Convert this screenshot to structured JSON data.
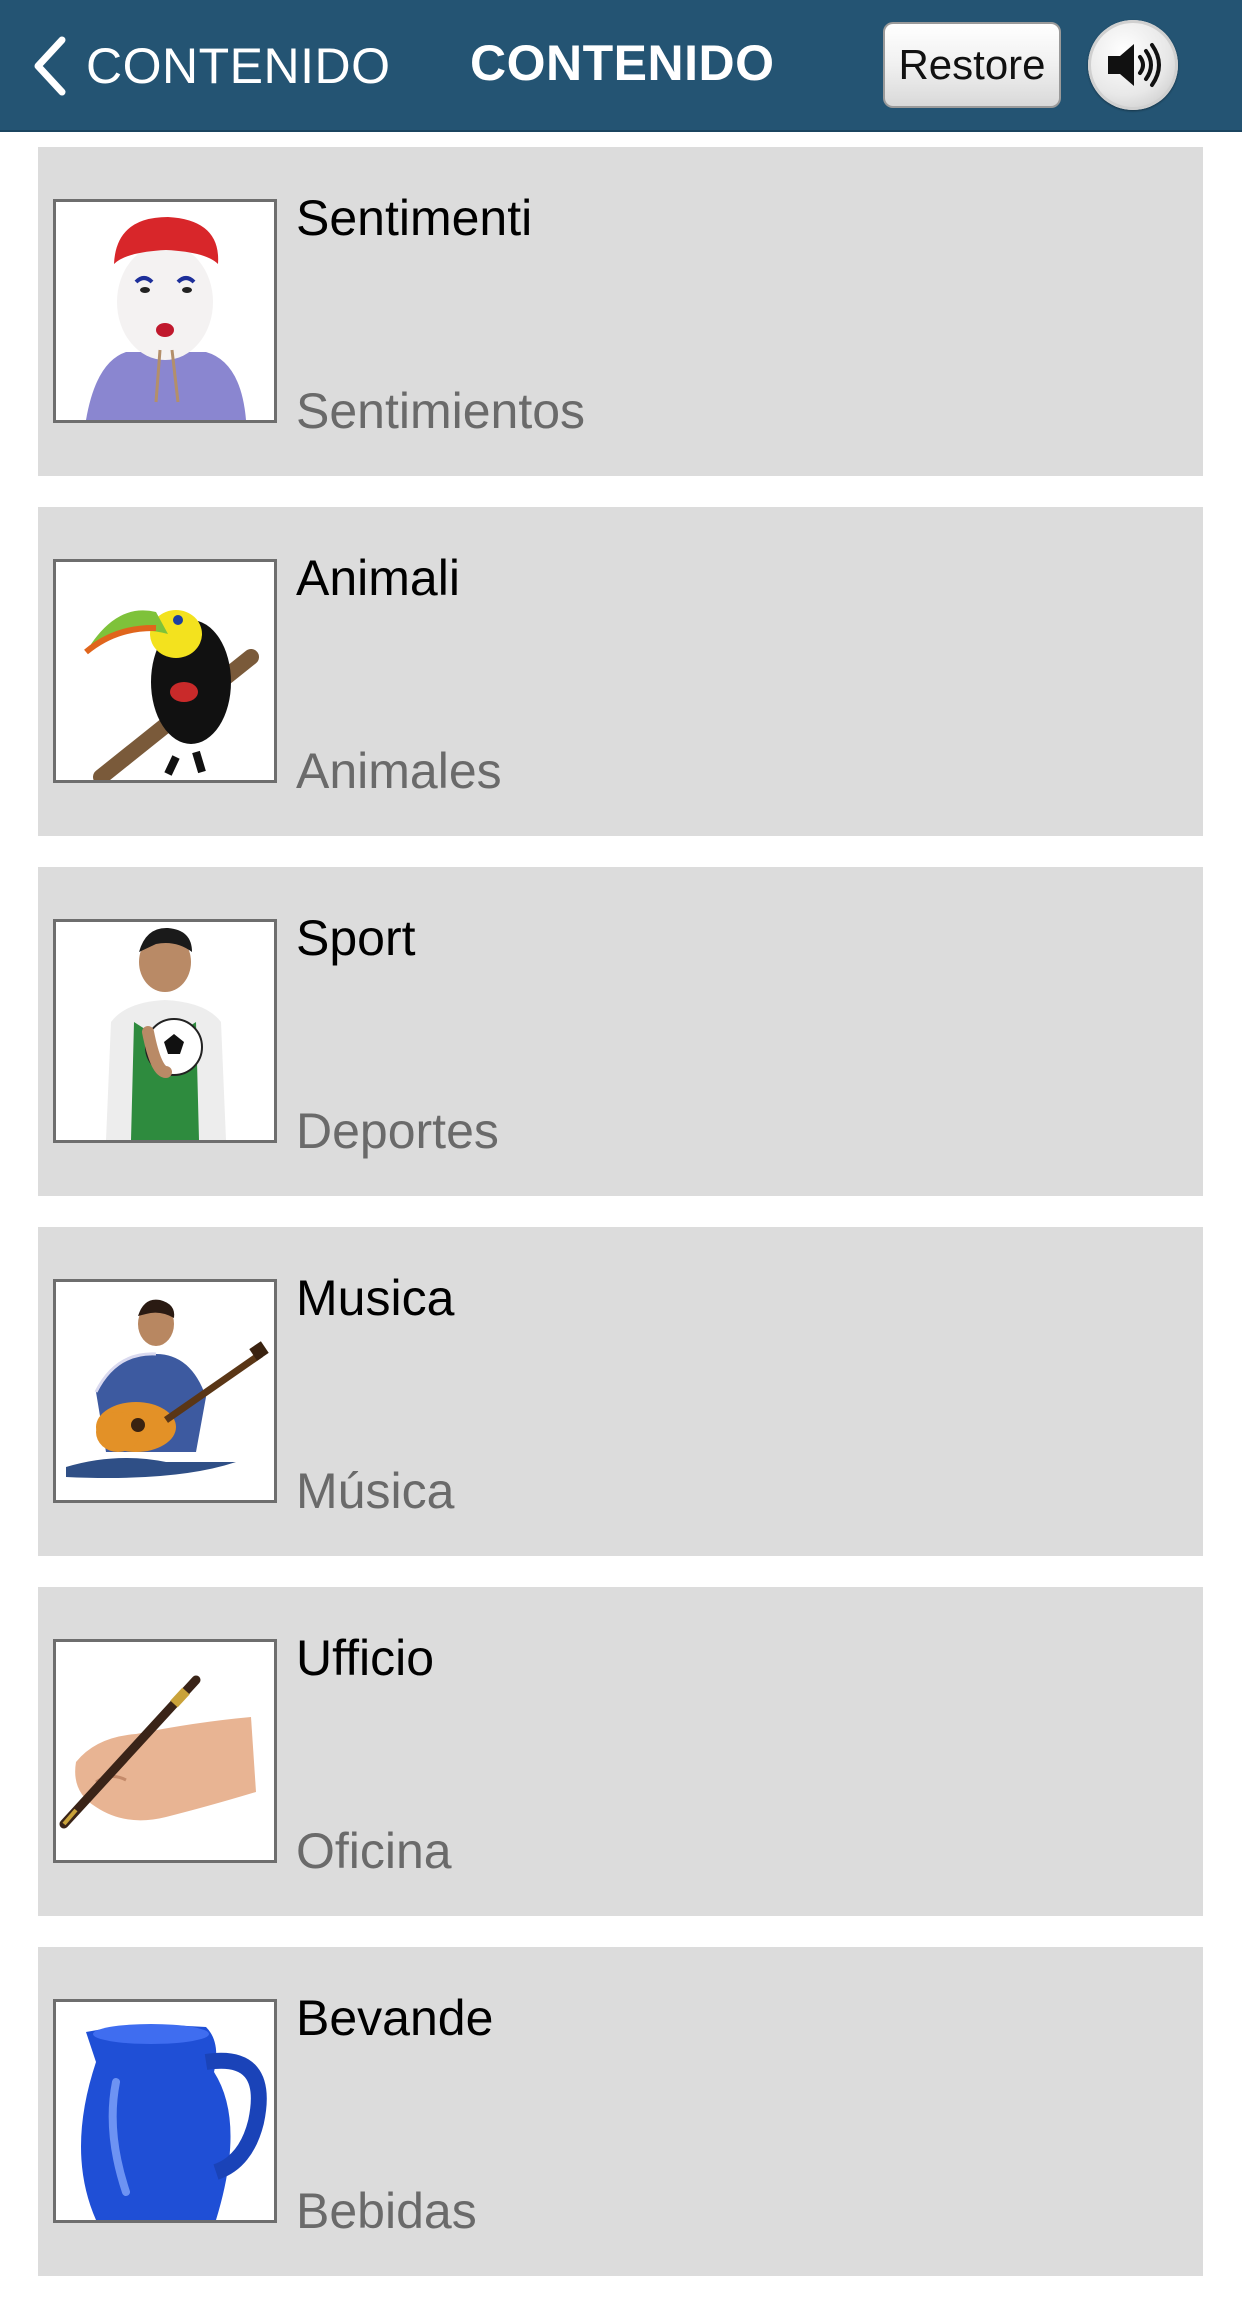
{
  "nav": {
    "back_label": "CONTENIDO",
    "title": "CONTENIDO",
    "restore_label": "Restore",
    "sound_icon": "speaker-volume-icon"
  },
  "categories": [
    {
      "title": "Sentimenti",
      "subtitle": "Sentimientos",
      "image": "clown-face-image"
    },
    {
      "title": "Animali",
      "subtitle": "Animales",
      "image": "toucan-image"
    },
    {
      "title": "Sport",
      "subtitle": "Deportes",
      "image": "soccer-player-image"
    },
    {
      "title": "Musica",
      "subtitle": "Música",
      "image": "guitar-player-image"
    },
    {
      "title": "Ufficio",
      "subtitle": "Oficina",
      "image": "hand-writing-pen-image"
    },
    {
      "title": "Bevande",
      "subtitle": "Bebidas",
      "image": "blue-pitcher-image"
    }
  ],
  "colors": {
    "navbar": "#245473",
    "row_background": "#dcdcdc",
    "subtitle_text": "#6a6a6a"
  }
}
